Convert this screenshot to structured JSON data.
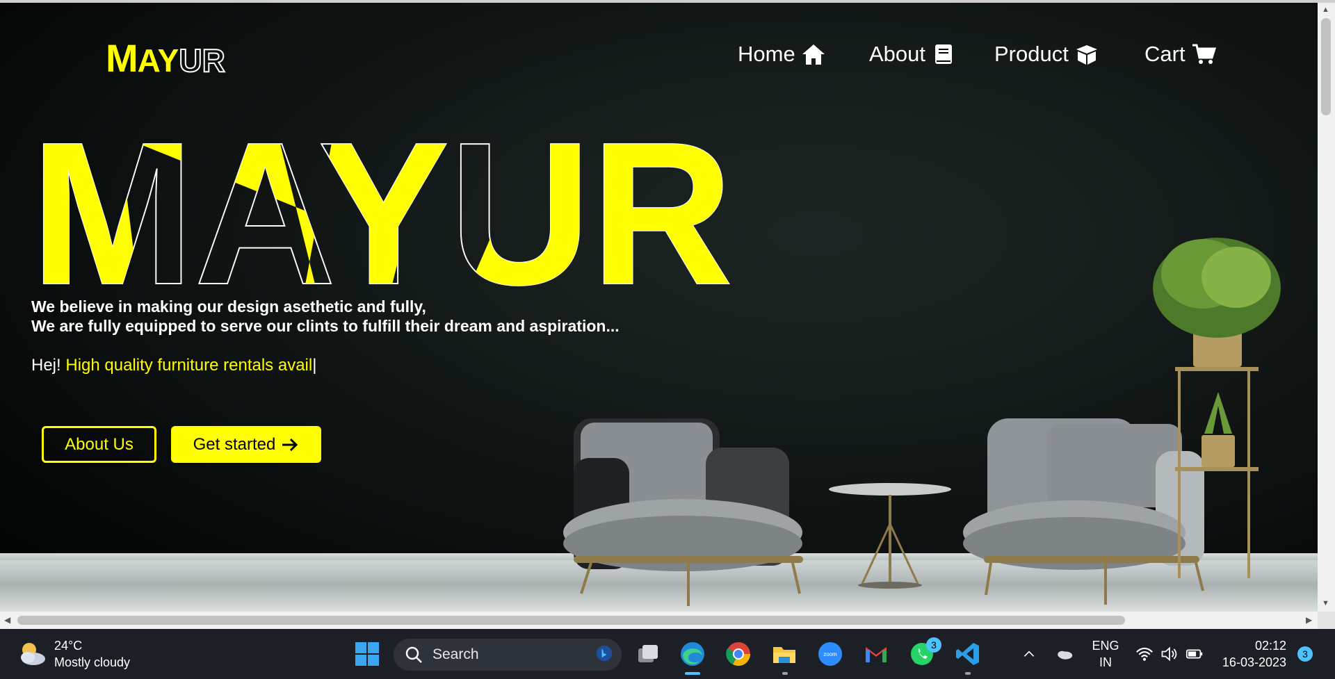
{
  "nav": {
    "logo_part1": "M",
    "logo_part2": "AY",
    "logo_part3": "UR",
    "home_label": "Home",
    "about_label": "About",
    "product_label": "Product",
    "cart_label": "Cart",
    "home_icon": "house-icon",
    "about_icon": "book-icon",
    "product_icon": "box-icon",
    "cart_icon": "cart-icon"
  },
  "hero": {
    "title": "MAYUR",
    "tagline_line1": "We believe in making our design asethetic and fully,",
    "tagline_line2": "We are fully equipped to serve our clints to fulfill their dream and aspiration...",
    "greeting": "Hej!",
    "typed_text": "High quality furniture rentals avail",
    "caret": "|",
    "about_button": "About Us",
    "start_button": "Get started"
  },
  "colors": {
    "accent": "#ffff00",
    "background": "#0b0f0e",
    "text": "#ffffff"
  },
  "taskbar": {
    "temperature": "24°C",
    "weather": "Mostly cloudy",
    "search_placeholder": "Search",
    "whatsapp_badge": "3",
    "lang_line1": "ENG",
    "lang_line2": "IN",
    "time": "02:12",
    "date": "16-03-2023",
    "notification_count": "3",
    "pinned_apps": [
      "start-icon",
      "task-view-icon",
      "edge-icon",
      "chrome-icon",
      "file-explorer-icon",
      "zoom-icon",
      "gmail-icon",
      "whatsapp-icon",
      "vscode-icon"
    ],
    "zoom_label": "zoom"
  }
}
